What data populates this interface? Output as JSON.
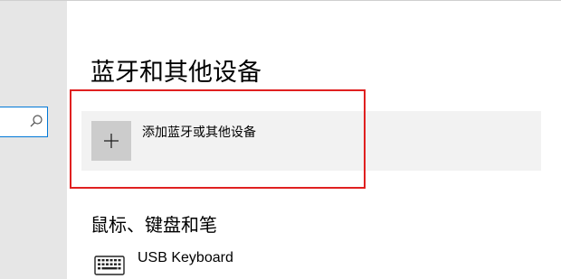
{
  "page": {
    "title": "蓝牙和其他设备",
    "add_device_label": "添加蓝牙或其他设备",
    "section_heading": "鼠标、键盘和笔",
    "devices": [
      {
        "name": "USB Keyboard",
        "icon": "keyboard-icon"
      }
    ]
  },
  "sidebar": {
    "search": {
      "value": "",
      "icon": "search-icon"
    }
  },
  "icons": {
    "add": "plus-icon"
  },
  "colors": {
    "highlight": "#e02020",
    "accent": "#0078d7",
    "sidebar_bg": "#e6e6e6",
    "row_bg": "#f2f2f2",
    "tile_bg": "#cccccc"
  }
}
